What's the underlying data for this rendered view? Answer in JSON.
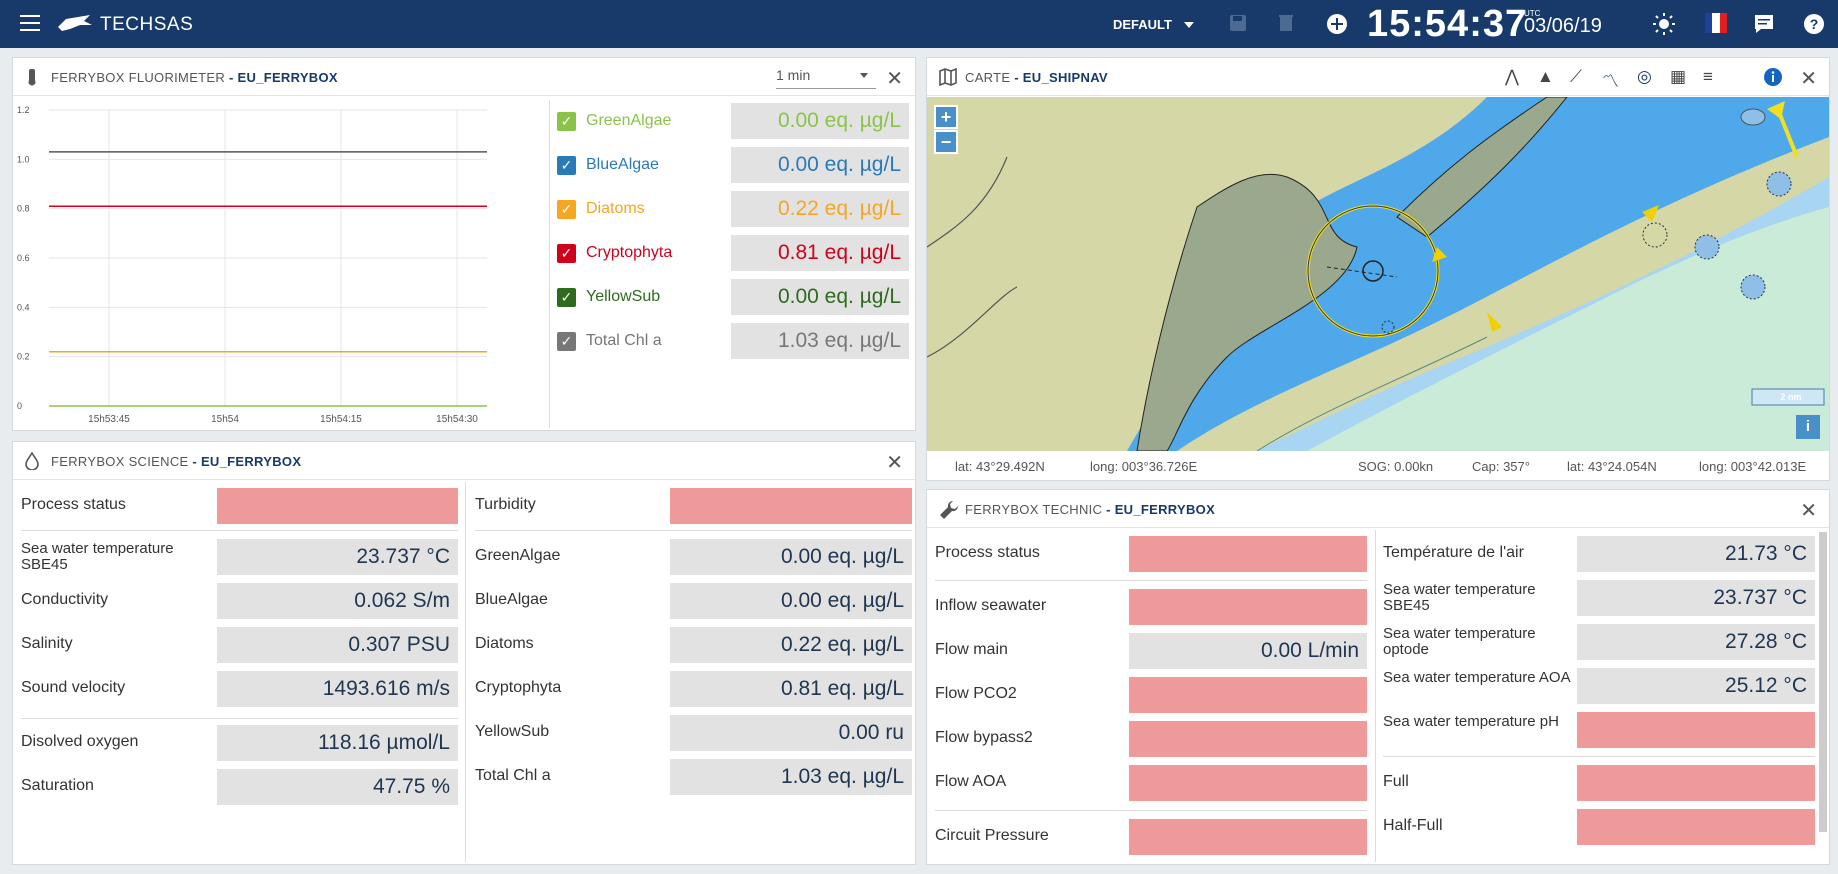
{
  "topbar": {
    "brand": "TECHSAS",
    "profile": "DEFAULT",
    "time": "15:54:37",
    "utc": "UTC",
    "date": "03/06/19"
  },
  "fluo": {
    "title": "FERRYBOX FLUORIMETER",
    "source": "- EU_FERRYBOX",
    "interval": "1 min",
    "legend": [
      {
        "name": "GreenAlgae",
        "value": "0.00 eq. µg/L",
        "color": "#8bc34a"
      },
      {
        "name": "BlueAlgae",
        "value": "0.00 eq. µg/L",
        "color": "#2a7ab8"
      },
      {
        "name": "Diatoms",
        "value": "0.22 eq. µg/L",
        "color": "#f5a623"
      },
      {
        "name": "Cryptophyta",
        "value": "0.81 eq. µg/L",
        "color": "#d0021b"
      },
      {
        "name": "YellowSub",
        "value": "0.00 eq. µg/L",
        "color": "#2e6b1f"
      },
      {
        "name": "Total Chl a",
        "value": "1.03 eq. µg/L",
        "color": "#777777"
      }
    ]
  },
  "chart_data": {
    "type": "line",
    "x": [
      "15h53:45",
      "15h54",
      "15h54:15",
      "15h54:30"
    ],
    "ylim": [
      0,
      1.2
    ],
    "yticks": [
      "1.2",
      "1.0",
      "0.8",
      "0.6",
      "0.4",
      "0.2",
      "0"
    ],
    "series": [
      {
        "name": "Total Chl a",
        "color": "#555555",
        "values": [
          1.03,
          1.03,
          1.03,
          1.03
        ]
      },
      {
        "name": "Cryptophyta",
        "color": "#d0021b",
        "values": [
          0.81,
          0.81,
          0.81,
          0.81
        ]
      },
      {
        "name": "Diatoms",
        "color": "#f5a623",
        "values": [
          0.22,
          0.22,
          0.22,
          0.22
        ]
      },
      {
        "name": "GreenAlgae",
        "color": "#8bc34a",
        "values": [
          0,
          0,
          0,
          0
        ]
      }
    ]
  },
  "science": {
    "title": "FERRYBOX SCIENCE",
    "source": "- EU_FERRYBOX",
    "left": [
      {
        "label": "Process status",
        "value": "",
        "status": "red"
      },
      {
        "label": "Sea water temperature SBE45",
        "value": "23.737 °C"
      },
      {
        "label": "Conductivity",
        "value": "0.062 S/m"
      },
      {
        "label": "Salinity",
        "value": "0.307 PSU"
      },
      {
        "label": "Sound velocity",
        "value": "1493.616 m/s"
      },
      {
        "label": "Disolved oxygen",
        "value": "118.16 µmol/L"
      },
      {
        "label": "Saturation",
        "value": "47.75 %"
      }
    ],
    "right": [
      {
        "label": "Turbidity",
        "value": "",
        "status": "red"
      },
      {
        "label": "GreenAlgae",
        "value": "0.00 eq. µg/L"
      },
      {
        "label": "BlueAlgae",
        "value": "0.00 eq. µg/L"
      },
      {
        "label": "Diatoms",
        "value": "0.22 eq. µg/L"
      },
      {
        "label": "Cryptophyta",
        "value": "0.81 eq. µg/L"
      },
      {
        "label": "YellowSub",
        "value": "0.00 ru"
      },
      {
        "label": "Total Chl a",
        "value": "1.03 eq. µg/L"
      }
    ]
  },
  "map": {
    "title": "CARTE",
    "source": "- EU_SHIPNAV",
    "lat1": "lat: 43°29.492N",
    "long1": "long: 003°36.726E",
    "sog": "SOG: 0.00kn",
    "cap": "Cap: 357°",
    "lat2": "lat: 43°24.054N",
    "long2": "long: 003°42.013E",
    "scale": "2 nm",
    "zoom_in": "+",
    "zoom_out": "−",
    "info": "i"
  },
  "technic": {
    "title": "FERRYBOX TECHNIC",
    "source": "- EU_FERRYBOX",
    "left": [
      {
        "label": "Process status",
        "value": "",
        "status": "red"
      },
      {
        "label": "Inflow seawater",
        "value": "",
        "status": "red"
      },
      {
        "label": "Flow main",
        "value": "0.00 L/min"
      },
      {
        "label": "Flow PCO2",
        "value": "",
        "status": "red"
      },
      {
        "label": "Flow bypass2",
        "value": "",
        "status": "red"
      },
      {
        "label": "Flow AOA",
        "value": "",
        "status": "red"
      },
      {
        "label": "Circuit Pressure",
        "value": "",
        "status": "red"
      }
    ],
    "right": [
      {
        "label": "Température de l'air",
        "value": "21.73 °C"
      },
      {
        "label": "Sea water temperature SBE45",
        "value": "23.737 °C"
      },
      {
        "label": "Sea water temperature optode",
        "value": "27.28 °C"
      },
      {
        "label": "Sea water temperature AOA",
        "value": "25.12 °C"
      },
      {
        "label": "Sea water temperature pH",
        "value": "",
        "status": "red"
      },
      {
        "label": "Full",
        "value": "",
        "status": "red"
      },
      {
        "label": "Half-Full",
        "value": "",
        "status": "red"
      }
    ]
  }
}
